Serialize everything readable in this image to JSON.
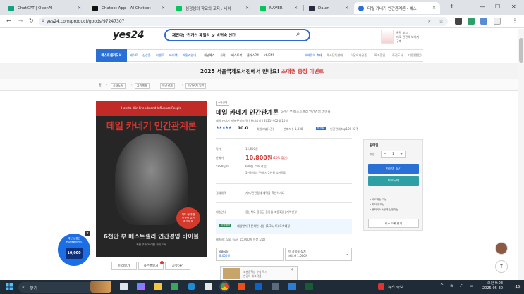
{
  "browser": {
    "tabs": [
      {
        "title": "ChatGPT | OpenAI",
        "favicon_color": "#10a37f"
      },
      {
        "title": "Chatbot App – AI Chatbot",
        "favicon_color": "#111111"
      },
      {
        "title": "심청섬의 학교와 교육 : 네이",
        "favicon_color": "#03c75a"
      },
      {
        "title": "NAVER",
        "favicon_color": "#03c75a"
      },
      {
        "title": "Daum",
        "favicon_color": "#2a2a3c"
      },
      {
        "title": "데일 카네기 인간관계론 - 예스",
        "favicon_color": "#2a6fd6"
      }
    ],
    "new_tab": "+",
    "url": "yes24.com/product/goods/97247307"
  },
  "header": {
    "logo": "yes24",
    "search_value": "재밌다! '천개산 패밀리 5' 박현숙 신간",
    "banner_text": "클릭 보고\n더로 깐깐해 보이게\n구매"
  },
  "menu": {
    "first": "베스트셀러도서",
    "items": [
      "베스트",
      "신상품",
      "이벤트",
      "바이백",
      "패밀리안내"
    ],
    "items2": [
      "채널예스",
      "사락",
      "베스트북",
      "클래스24",
      "rb/ENS"
    ],
    "right": [
      "새해맞이 축제",
      "예사단독판매",
      "이달의사은품",
      "특가할인",
      "주전도서",
      "대림(랭킹)"
    ]
  },
  "promo": {
    "text": "2025 서울국제도서전에서 만나요!",
    "highlight": "초대권 증정 이벤트"
  },
  "breadcrumb": [
    "홈",
    "국내도서",
    "자기계발",
    "인간관계",
    "인간관계 일반"
  ],
  "cover": {
    "subtitle": "How to Win Friends and Influence People",
    "title": "데일 카네기 인간관계론",
    "bottom": "6천만 부 베스트셀러 인간경영 바이블",
    "bottom2": "독판 부와 30여만 최대 도서",
    "badge": "미도 현 추천\n인문학 고전\n최고의 책"
  },
  "cover_buttons": [
    "미리보기",
    "사은품보기",
    "공유하기"
  ],
  "card_ad": {
    "text": "예산 상품권\n현대백화점카드",
    "card": "10,000",
    "close": "×"
  },
  "product": {
    "small_badge": "소득공제",
    "title": "데일 카네기 인간관계론",
    "subtitle": "6천만 부 베스트셀러 인간경영 바이블",
    "author_line": "데일 카네기 저/바른북스 역 | 현대지성 | 2021년 02월 10일",
    "stars": "★★★★★",
    "rating": "10.0",
    "review_count": "회원리뷰(1건)",
    "sales_index": "판매지수 1,038",
    "rank_badge": "베스트",
    "rank_text": "인간관계 top100 22주",
    "price_label": "정가",
    "price": "12,800원",
    "sale_label": "판매가",
    "sale_price": "10,800원",
    "sale_rate": "(10% 할인)",
    "points_label": "YES포인트",
    "points": "600원 (5% 적립)",
    "points_extra": "5만원이상 구매 시 2천원 추가적립",
    "benefit_label": "결제혜택",
    "benefit": "카드/간편결제 혜택을 확인하세요",
    "ship_label": "배송안내",
    "ship": "울산북도 울릉군 울릉읍 조용1길 | 지역변경",
    "today_badge": "지역배송",
    "delivery": "내일받기 주문하면 내일 (5/31, 토) 도착예정",
    "shipping_fee": "배송비 : 무료 (도서 15,000원 이상 무료)",
    "ebook_label": "eBook",
    "ebook_price": "8,000원",
    "other_label": "이 상품을 찾기",
    "other_price": "재입가 1,000원",
    "ad_text": "노벨문학상 수상 작가\n한강의 대표작품"
  },
  "panel": {
    "title": "판매일",
    "qty_label": "수량",
    "qty": "1",
    "cart": "카트에 넣기",
    "buy": "바로구매",
    "list": [
      "바로배송 가능",
      "최저가 보상",
      "문화비소득공제 신청가능"
    ],
    "wish": "리스트에 넣기"
  },
  "taskbar": {
    "search": "찾기",
    "news": "뉴스 속보",
    "time": "오전 9:03",
    "date": "2025-05-30",
    "badge": "15"
  }
}
